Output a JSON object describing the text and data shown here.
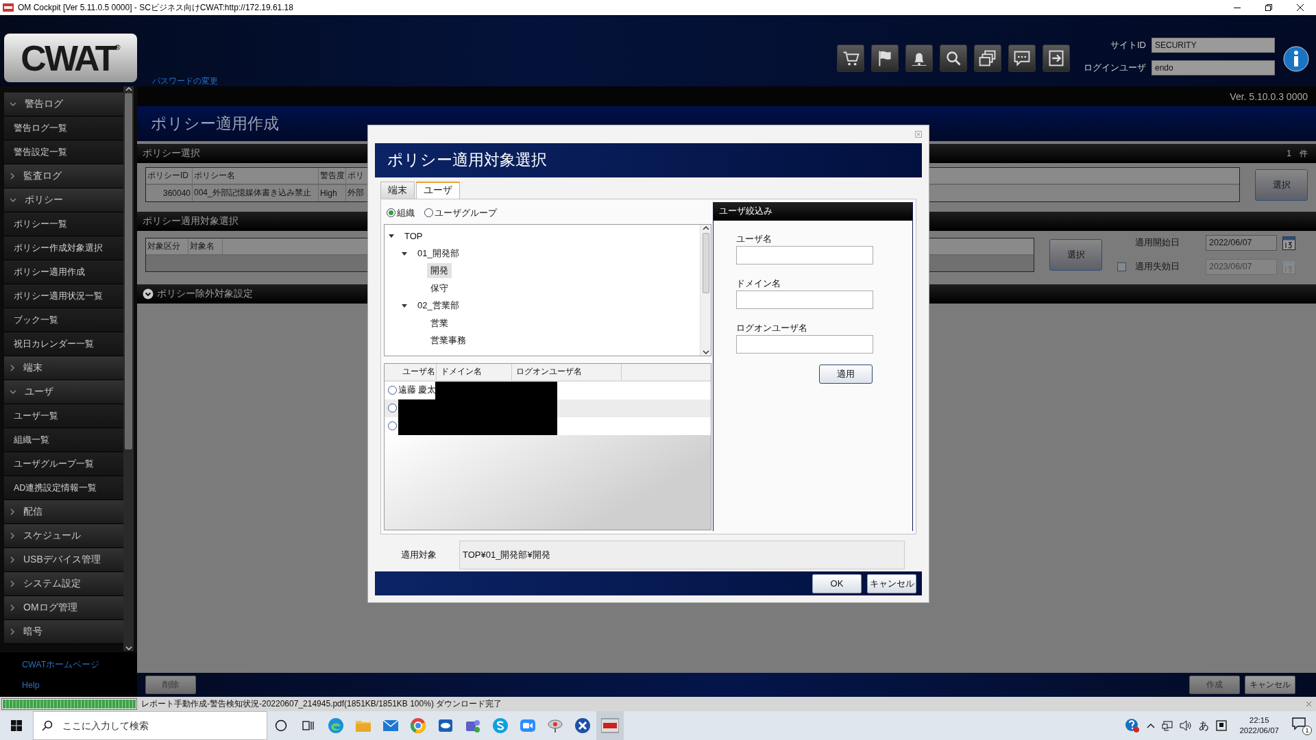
{
  "title_bar": {
    "title": "OM Cockpit  [Ver 5.11.0.5 0000] - SCビジネス向けCWAT:http://172.19.61.18"
  },
  "header": {
    "logo": "CWAT",
    "logo_mark": "®",
    "password_link": "パスワードの変更",
    "site_id_label": "サイトID",
    "site_id": "SECURITY",
    "login_user_label": "ログインユーザ",
    "login_user": "endo",
    "version": "Ver. 5.10.0.3 0000"
  },
  "sidebar": {
    "groups": [
      {
        "label": "警告ログ",
        "expanded": true,
        "items": [
          {
            "label": "警告ログ一覧",
            "selected": false
          },
          {
            "label": "警告設定一覧",
            "selected": false
          }
        ]
      },
      {
        "label": "監査ログ",
        "expanded": false
      },
      {
        "label": "ポリシー",
        "expanded": true,
        "items": [
          {
            "label": "ポリシー一覧",
            "selected": false
          },
          {
            "label": "ポリシー作成対象選択",
            "selected": false
          },
          {
            "label": "ポリシー適用作成",
            "selected": false
          },
          {
            "label": "ポリシー適用状況一覧",
            "selected": false
          },
          {
            "label": "ブック一覧",
            "selected": false
          },
          {
            "label": "祝日カレンダー一覧",
            "selected": false
          }
        ]
      },
      {
        "label": "端末",
        "expanded": false
      },
      {
        "label": "ユーザ",
        "expanded": true,
        "items": [
          {
            "label": "ユーザ一覧",
            "selected": false
          },
          {
            "label": "組織一覧",
            "selected": false
          },
          {
            "label": "ユーザグループ一覧",
            "selected": false
          },
          {
            "label": "AD連携設定情報一覧",
            "selected": false
          }
        ]
      },
      {
        "label": "配信",
        "expanded": false
      },
      {
        "label": "スケジュール",
        "expanded": false
      },
      {
        "label": "USBデバイス管理",
        "expanded": false
      },
      {
        "label": "システム設定",
        "expanded": false
      },
      {
        "label": "OMログ管理",
        "expanded": false
      },
      {
        "label": "暗号",
        "expanded": false
      }
    ],
    "links": [
      "CWATホームページ",
      "Help"
    ]
  },
  "page": {
    "title": "ポリシー適用作成",
    "policy_section": {
      "title": "ポリシー選択",
      "count": "1　件",
      "columns": [
        "ポリシーID",
        "ポリシー名",
        "警告度",
        "ポリ"
      ],
      "rows": [
        [
          "360040",
          "004_外部記憶媒体書き込み禁止",
          "High",
          "外部"
        ]
      ],
      "select_button": "選択"
    },
    "target_section": {
      "title": "ポリシー適用対象選択",
      "columns": [
        "対象区分",
        "対象名"
      ],
      "select_button": "選択",
      "start_date_label": "適用開始日",
      "start_date": "2022/06/07",
      "expiry": {
        "label": "適用失効日",
        "checked": false,
        "date": "2023/06/07"
      }
    },
    "exclusion_section": {
      "title": "ポリシー除外対象設定"
    }
  },
  "bottom_bar": {
    "delete_button": "削除",
    "create_button": "作成",
    "cancel_button": "キャンセル"
  },
  "status_bar": {
    "message": "レポート手動作成-警告検知状況-20220607_214945.pdf(1851KB/1851KB 100%) ダウンロード完了",
    "level": 1
  },
  "taskbar": {
    "search_placeholder": "ここに入力して検索",
    "ime": "あ",
    "time": "22:15",
    "date": "2022/06/07",
    "notifications": "1"
  },
  "dialog": {
    "title": "ポリシー適用対象選択",
    "tabs": [
      {
        "label": "端末",
        "selected": false
      },
      {
        "label": "ユーザ",
        "selected": true
      }
    ],
    "scopes": [
      {
        "label": "組織",
        "selected": true
      },
      {
        "label": "ユーザグループ",
        "selected": false
      }
    ],
    "tree": [
      {
        "label": "TOP",
        "expanded": true,
        "selected": false,
        "children": [
          {
            "label": "01_開発部",
            "expanded": true,
            "selected": false,
            "children": [
              {
                "label": "開発",
                "selected": true
              },
              {
                "label": "保守",
                "selected": false
              }
            ]
          },
          {
            "label": "02_営業部",
            "expanded": true,
            "selected": false,
            "children": [
              {
                "label": "営業",
                "selected": false
              },
              {
                "label": "営業事務",
                "selected": false
              }
            ]
          }
        ]
      }
    ],
    "users": {
      "columns": [
        "ユーザ名",
        "ドメイン名",
        "ログオンユーザ名"
      ],
      "rows": [
        {
          "user_name": "遠藤 慶太",
          "selected": false,
          "redacted": true
        },
        {
          "selected": false,
          "redacted": true
        },
        {
          "selected": false,
          "redacted": true
        }
      ]
    },
    "filter": {
      "title": "ユーザ絞込み",
      "fields": [
        {
          "label": "ユーザ名"
        },
        {
          "label": "ドメイン名"
        },
        {
          "label": "ログオンユーザ名"
        }
      ],
      "apply_button": "適用"
    },
    "target_label": "適用対象",
    "target_value": "TOP¥01_開発部¥開発",
    "ok_button": "OK",
    "cancel_button": "キャンセル"
  }
}
